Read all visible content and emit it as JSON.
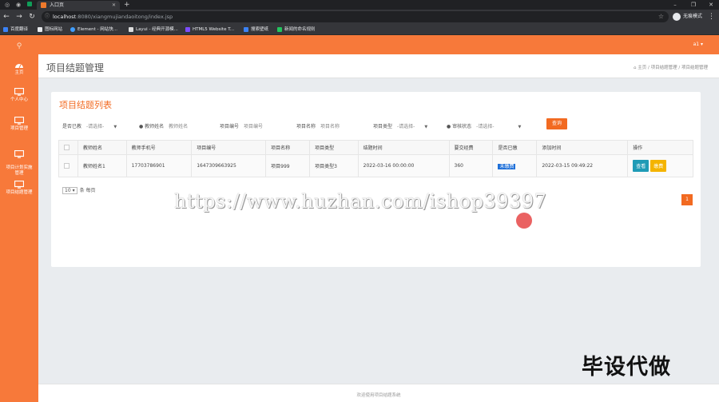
{
  "browser": {
    "tab_title": "入口页",
    "url_host": "localhost",
    "url_rest": ":8080/xiangmujiandaoitong/index.jsp",
    "incognito_label": "无痕模式",
    "bookmarks": [
      {
        "label": "百度翻译",
        "color": "#3b82f6"
      },
      {
        "label": "图标网站",
        "color": "#e8eaed"
      },
      {
        "label": "Element - 网站快...",
        "color": "#409eff"
      },
      {
        "label": "Layui - 经典开源模...",
        "color": "#dddddd"
      },
      {
        "label": "HTML5 Website T...",
        "color": "#7c4dff"
      },
      {
        "label": "搜索壁纸",
        "color": "#3b82f6"
      },
      {
        "label": "新闻的命名规则",
        "color": "#22c55e"
      }
    ]
  },
  "sidebar": {
    "items": [
      {
        "label": "主页"
      },
      {
        "label": "个人中心"
      },
      {
        "label": "项目管理"
      },
      {
        "label": "项目计划实施\n管理"
      },
      {
        "label": "项目结题管理"
      }
    ]
  },
  "topbar": {
    "user": "a1 ▾"
  },
  "page": {
    "title": "项目结题管理",
    "breadcrumb": [
      "主页",
      "项目结题管理",
      "项目结题管理"
    ]
  },
  "card": {
    "title": "项目结题列表",
    "filters": [
      {
        "label": "是否已教",
        "value": "-请选择-",
        "type": "select"
      },
      {
        "label": "教师姓名",
        "value": "教师姓名",
        "type": "input"
      },
      {
        "label": "项目编号",
        "value": "项目编号",
        "type": "input"
      },
      {
        "label": "项目名称",
        "value": "项目名称",
        "type": "input"
      },
      {
        "label": "项目类型",
        "value": "-请选择-",
        "type": "select"
      },
      {
        "label": "审核状态",
        "value": "-请选择-",
        "type": "select"
      }
    ],
    "query_button": "查询",
    "columns": [
      "",
      "教师姓名",
      "教师手机号",
      "项目编号",
      "项目名称",
      "项目类型",
      "结题时间",
      "要交经费",
      "是否已缴",
      "添加时间",
      "操作"
    ],
    "rows": [
      [
        "",
        "教师姓名1",
        "17703786901",
        "1647309663925",
        "项目999",
        "项目类型3",
        "2022-03-16 00:00:00",
        "360",
        "未缴费",
        "2022-03-15 09:49:22",
        ""
      ]
    ],
    "row_actions": {
      "view": "查看",
      "review": "缴费"
    },
    "page_size": "10",
    "page_size_suffix": "条 每页",
    "current_page": "1"
  },
  "footer": {
    "text": "欢迎使用项目结题系统"
  },
  "overlay": {
    "watermark": "https://www.huzhan.com/ishop39397",
    "promo": "毕设代做"
  }
}
